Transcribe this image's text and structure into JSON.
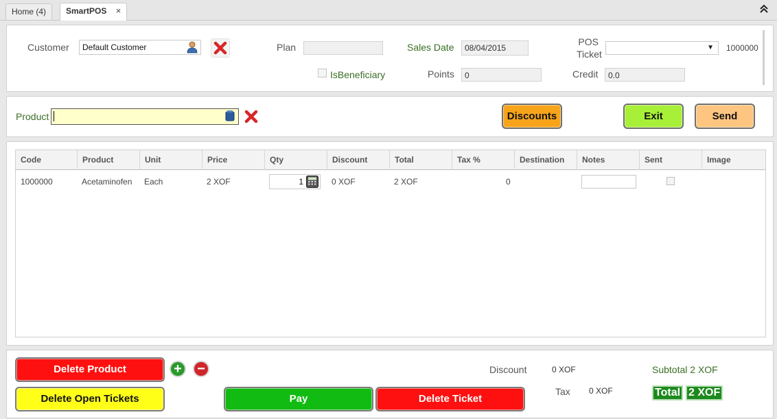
{
  "tabs": [
    {
      "label": "Home (4)"
    },
    {
      "label": "SmartPOS",
      "close": "×"
    }
  ],
  "header": {
    "customer_label": "Customer",
    "customer_value": "Default Customer",
    "plan_label": "Plan",
    "plan_value": "",
    "sales_date_label": "Sales Date",
    "sales_date_value": "08/04/2015",
    "pos_ticket_label_1": "POS",
    "pos_ticket_label_2": "Ticket",
    "pos_ticket_value": "",
    "ticket_number": "1000000",
    "is_beneficiary_label": "IsBeneficiary",
    "is_beneficiary_checked": false,
    "points_label": "Points",
    "points_value": "0",
    "credit_label": "Credit",
    "credit_value": "0.0"
  },
  "product_bar": {
    "product_label": "Product",
    "product_value": "",
    "discounts_label": "Discounts",
    "exit_label": "Exit",
    "send_label": "Send"
  },
  "table": {
    "columns": [
      "Code",
      "Product",
      "Unit",
      "Price",
      "Qty",
      "Discount",
      "Total",
      "Tax %",
      "Destination",
      "Notes",
      "Sent",
      "Image"
    ],
    "rows": [
      {
        "code": "1000000",
        "product": "Acetaminofen",
        "unit": "Each",
        "price": "2 XOF",
        "qty": "1",
        "discount": "0 XOF",
        "total": "2 XOF",
        "tax": "0",
        "destination": "",
        "notes": "",
        "sent": false,
        "image": ""
      }
    ]
  },
  "footer": {
    "delete_product_label": "Delete Product",
    "delete_open_tickets_label": "Delete Open Tickets",
    "pay_label": "Pay",
    "delete_ticket_label": "Delete Ticket",
    "plus_symbol": "+",
    "minus_symbol": "−",
    "discount_label": "Discount",
    "discount_value": "0 XOF",
    "tax_label": "Tax",
    "tax_value": "0 XOF",
    "subtotal_text": "Subtotal 2 XOF",
    "total_label": "Total",
    "total_value": "2 XOF"
  },
  "icons": {
    "customer_lookup": "person-icon",
    "clear": "red-x-icon",
    "product_lookup": "blue-square-icon",
    "calculator": "calculator-icon",
    "collapse": "double-chevron-up-icon"
  },
  "colors": {
    "discounts_button": "#f7a41b",
    "exit_button": "#a8f038",
    "send_button": "#fdc580",
    "delete_button": "#ff1010",
    "open_tickets_button": "#ffff18",
    "pay_button": "#11bb11",
    "total_badge": "#1e8a1e",
    "product_field": "#ffffcc"
  }
}
